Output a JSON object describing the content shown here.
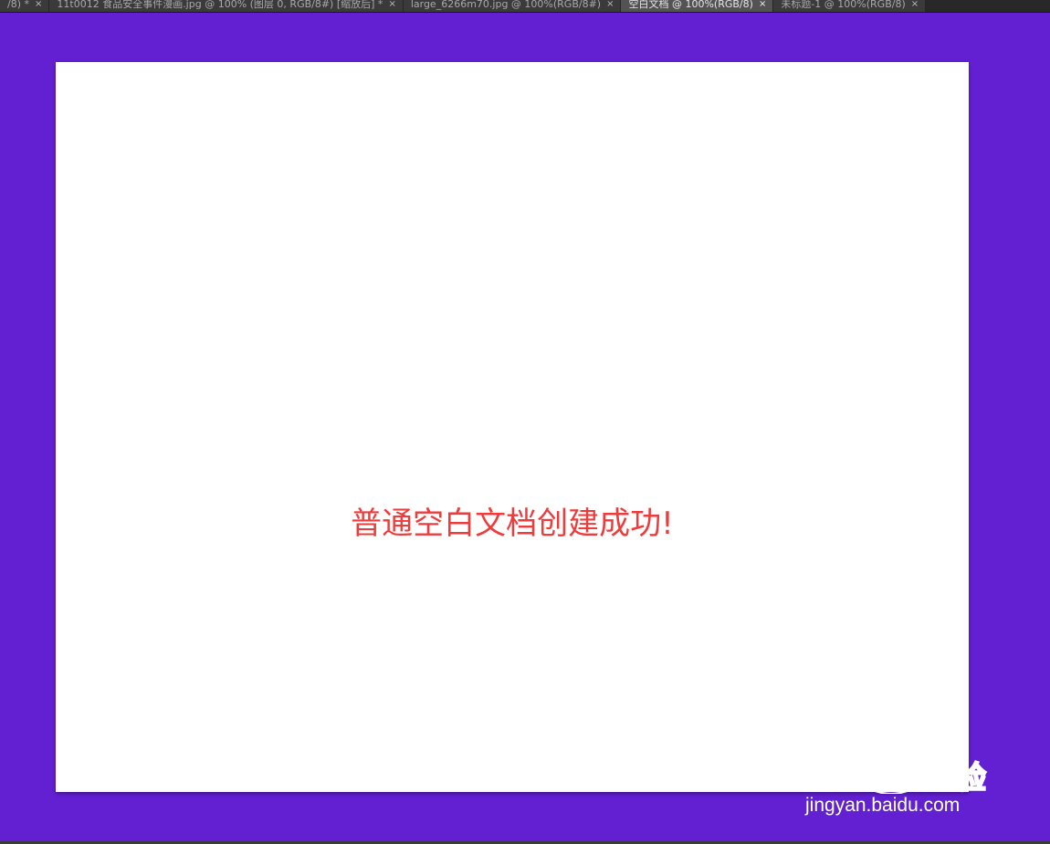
{
  "tabs": [
    {
      "label": "/8) *",
      "active": false
    },
    {
      "label": "11t0012 食品安全事件漫画.jpg @ 100% (图层 0, RGB/8#) [缩放后] *",
      "active": false
    },
    {
      "label": "large_6266m70.jpg @ 100%(RGB/8#)",
      "active": false
    },
    {
      "label": "空白文档 @ 100%(RGB/8)",
      "active": true
    },
    {
      "label": "未标题-1 @ 100%(RGB/8)",
      "active": false
    }
  ],
  "tab_close_glyph": "×",
  "canvas": {
    "message": "普通空白文档创建成功!"
  },
  "watermark": {
    "logo_text": "Bai du 经验",
    "url": "jingyan.baidu.com"
  },
  "colors": {
    "workspace_bg": "#6320d3",
    "canvas_bg": "#ffffff",
    "message_color": "#ee3b3b",
    "tabbar_bg": "#282828",
    "tab_active_bg": "#535353"
  }
}
